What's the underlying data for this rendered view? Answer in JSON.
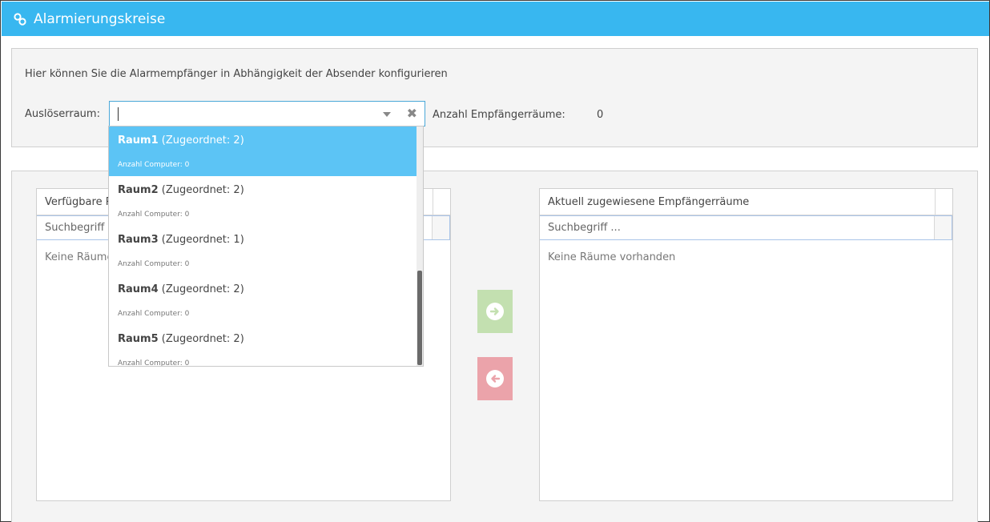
{
  "window": {
    "title": "Alarmierungskreise",
    "title_icon": "link-icon"
  },
  "config": {
    "description": "Hier können Sie die Alarmempfänger in Abhängigkeit der Absender konfigurieren",
    "trigger_label": "Auslöserraum:",
    "trigger_value": "",
    "recipient_count_label": "Anzahl Empfängerräume:",
    "recipient_count_value": "0"
  },
  "dropdown": {
    "items": [
      {
        "name": "Raum1",
        "assigned": "(Zugeordnet: 2)",
        "computers": "Anzahl Computer: 0",
        "active": true
      },
      {
        "name": "Raum2",
        "assigned": "(Zugeordnet: 2)",
        "computers": "Anzahl Computer: 0",
        "active": false
      },
      {
        "name": "Raum3",
        "assigned": "(Zugeordnet: 1)",
        "computers": "Anzahl Computer: 0",
        "active": false
      },
      {
        "name": "Raum4",
        "assigned": "(Zugeordnet: 2)",
        "computers": "Anzahl Computer: 0",
        "active": false
      },
      {
        "name": "Raum5",
        "assigned": "(Zugeordnet: 2)",
        "computers": "Anzahl Computer: 0",
        "active": false
      }
    ]
  },
  "available": {
    "header": "Verfügbare Räume",
    "search_placeholder": "Suchbegriff ...",
    "empty": "Keine Räume vorhanden"
  },
  "assigned": {
    "header": "Aktuell zugewiesene Empfängerräume",
    "search_placeholder": "Suchbegriff ...",
    "empty": "Keine Räume vorhanden"
  },
  "buttons": {
    "add_icon": "arrow-right-circle-icon",
    "remove_icon": "arrow-left-circle-icon",
    "add_color": "#c3e0b0",
    "remove_color": "#eba3aa"
  },
  "colors": {
    "titlebar": "#38b7f0",
    "selected_item": "#5cc4f5"
  }
}
